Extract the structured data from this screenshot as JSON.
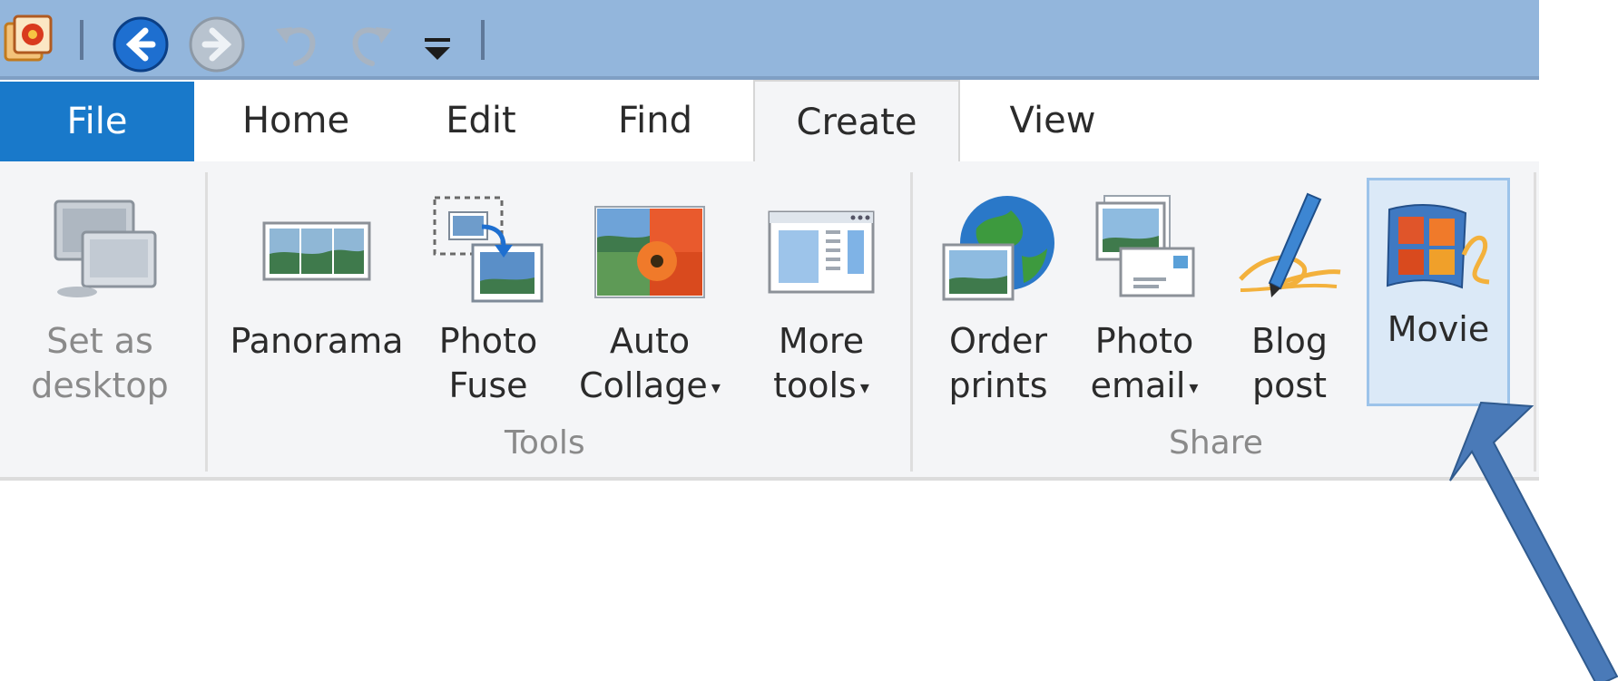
{
  "quick_access": {
    "icons": [
      "app-icon",
      "back-icon",
      "forward-icon",
      "undo-icon",
      "redo-icon",
      "customize-qat-icon"
    ]
  },
  "tabs": [
    {
      "label": "File"
    },
    {
      "label": "Home"
    },
    {
      "label": "Edit"
    },
    {
      "label": "Find"
    },
    {
      "label": "Create",
      "active": true
    },
    {
      "label": "View"
    }
  ],
  "ribbon": {
    "desktop": {
      "line1": "Set as",
      "line2": "desktop",
      "enabled": false
    },
    "tools": {
      "group_label": "Tools",
      "buttons": [
        {
          "line1": "Panorama",
          "line2": ""
        },
        {
          "line1": "Photo",
          "line2": "Fuse"
        },
        {
          "line1": "Auto",
          "line2": "Collage",
          "dropdown": true
        },
        {
          "line1": "More",
          "line2": "tools",
          "dropdown": true
        }
      ]
    },
    "share": {
      "group_label": "Share",
      "buttons": [
        {
          "line1": "Order",
          "line2": "prints"
        },
        {
          "line1": "Photo",
          "line2": "email",
          "dropdown": true
        },
        {
          "line1": "Blog",
          "line2": "post"
        },
        {
          "line1": "Movie",
          "line2": "",
          "selected": true
        }
      ]
    }
  },
  "colors": {
    "qat_background": "#93b6dc",
    "file_tab": "#1979ca",
    "ribbon_background": "#f4f5f7",
    "annotation_arrow": "#4a7ab8"
  }
}
